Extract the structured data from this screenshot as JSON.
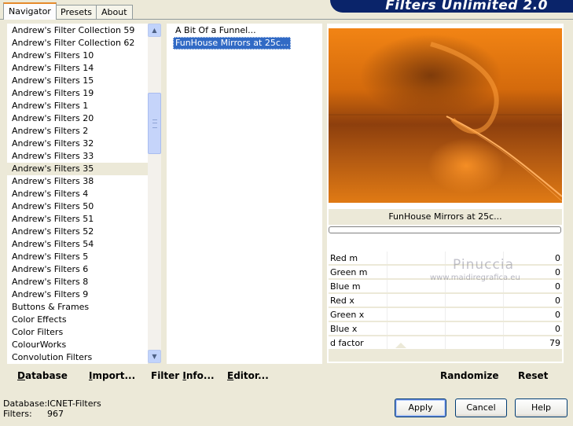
{
  "tabs": [
    {
      "label": "Navigator"
    },
    {
      "label": "Presets"
    },
    {
      "label": "About"
    }
  ],
  "banner": {
    "title": "Filters Unlimited 2.0"
  },
  "categories": [
    "Andrew's Filter Collection 59",
    "Andrew's Filter Collection 62",
    "Andrew's Filters 10",
    "Andrew's Filters 14",
    "Andrew's Filters 15",
    "Andrew's Filters 19",
    "Andrew's Filters 1",
    "Andrew's Filters 20",
    "Andrew's Filters 2",
    "Andrew's Filters 32",
    "Andrew's Filters 33",
    "Andrew's Filters 35",
    "Andrew's Filters 38",
    "Andrew's Filters 4",
    "Andrew's Filters 50",
    "Andrew's Filters 51",
    "Andrew's Filters 52",
    "Andrew's Filters 54",
    "Andrew's Filters 5",
    "Andrew's Filters 6",
    "Andrew's Filters 8",
    "Andrew's Filters 9",
    "Buttons & Frames",
    "Color Effects",
    "Color Filters",
    "ColourWorks",
    "Convolution Filters"
  ],
  "selected_category": "Andrew's Filters 35",
  "filters": [
    "A Bit Of a Funnel...",
    "FunHouse Mirrors at 25c..."
  ],
  "selected_filter": "FunHouse Mirrors at 25c...",
  "preview": {
    "caption": "FunHouse Mirrors at 25c..."
  },
  "params": [
    {
      "name": "Red m",
      "value": "0"
    },
    {
      "name": "Green m",
      "value": "0"
    },
    {
      "name": "Blue m",
      "value": "0"
    },
    {
      "name": "Red x",
      "value": "0"
    },
    {
      "name": "Green x",
      "value": "0"
    },
    {
      "name": "Blue x",
      "value": "0"
    },
    {
      "name": "d factor",
      "value": "79"
    }
  ],
  "watermark": {
    "name": "Pinuccia",
    "url": "www.maidiregrafica.eu"
  },
  "links": {
    "database": {
      "pre": "",
      "u": "D",
      "post": "atabase"
    },
    "import": {
      "pre": "",
      "u": "I",
      "post": "mport..."
    },
    "filter_info": {
      "pre": "Filter ",
      "u": "I",
      "post": "nfo..."
    },
    "editor": {
      "pre": "",
      "u": "E",
      "post": "ditor..."
    },
    "randomize": "Randomize",
    "reset": "Reset"
  },
  "status": {
    "database_label": "Database:",
    "database_value": "ICNET-Filters",
    "filters_label": "Filters:",
    "filters_value": "967"
  },
  "buttons": {
    "apply": "Apply",
    "cancel": "Cancel",
    "help": "Help"
  },
  "colors": {
    "accent_selection": "#316ac5",
    "banner": "#0a246a",
    "tab_highlight": "#e68b2c"
  }
}
